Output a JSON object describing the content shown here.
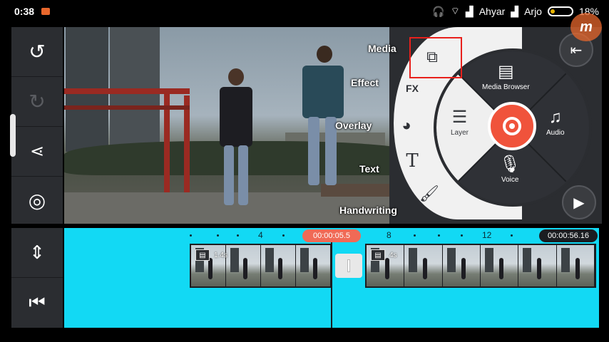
{
  "status_bar": {
    "time": "0:38",
    "carrier1": "Ahyar",
    "carrier2": "Arjo",
    "battery": "18%"
  },
  "left_toolbar": {
    "icons": [
      "undo-icon",
      "redo-icon",
      "share-icon",
      "settings-icon"
    ],
    "bottom_icons": [
      "timeline-expand-icon",
      "skip-to-start-icon"
    ]
  },
  "media_menu": {
    "arc_items": [
      {
        "label": "Media",
        "icon": "media-icon"
      },
      {
        "label": "Effect",
        "icon": "fx-icon"
      },
      {
        "label": "Overlay",
        "icon": "overlay-icon"
      },
      {
        "label": "Text",
        "icon": "text-icon"
      },
      {
        "label": "Handwriting",
        "icon": "brush-icon"
      }
    ],
    "wheel_items": {
      "media_browser": "Media Browser",
      "layer": "Layer",
      "audio": "Audio",
      "voice": "Voice"
    }
  },
  "watermark": "m",
  "timeline": {
    "current_time": "00:00:05.5",
    "total_time": "00:00:56.16",
    "ruler_numbers": [
      "4",
      "8",
      "12"
    ],
    "clip1_duration": "1.4s",
    "clip2_duration": "4s"
  },
  "colors": {
    "timeline_bg": "#12d9f4",
    "record_button": "#f0533b",
    "highlight_box": "#e8201c",
    "panel_bg": "#2b2d31"
  }
}
